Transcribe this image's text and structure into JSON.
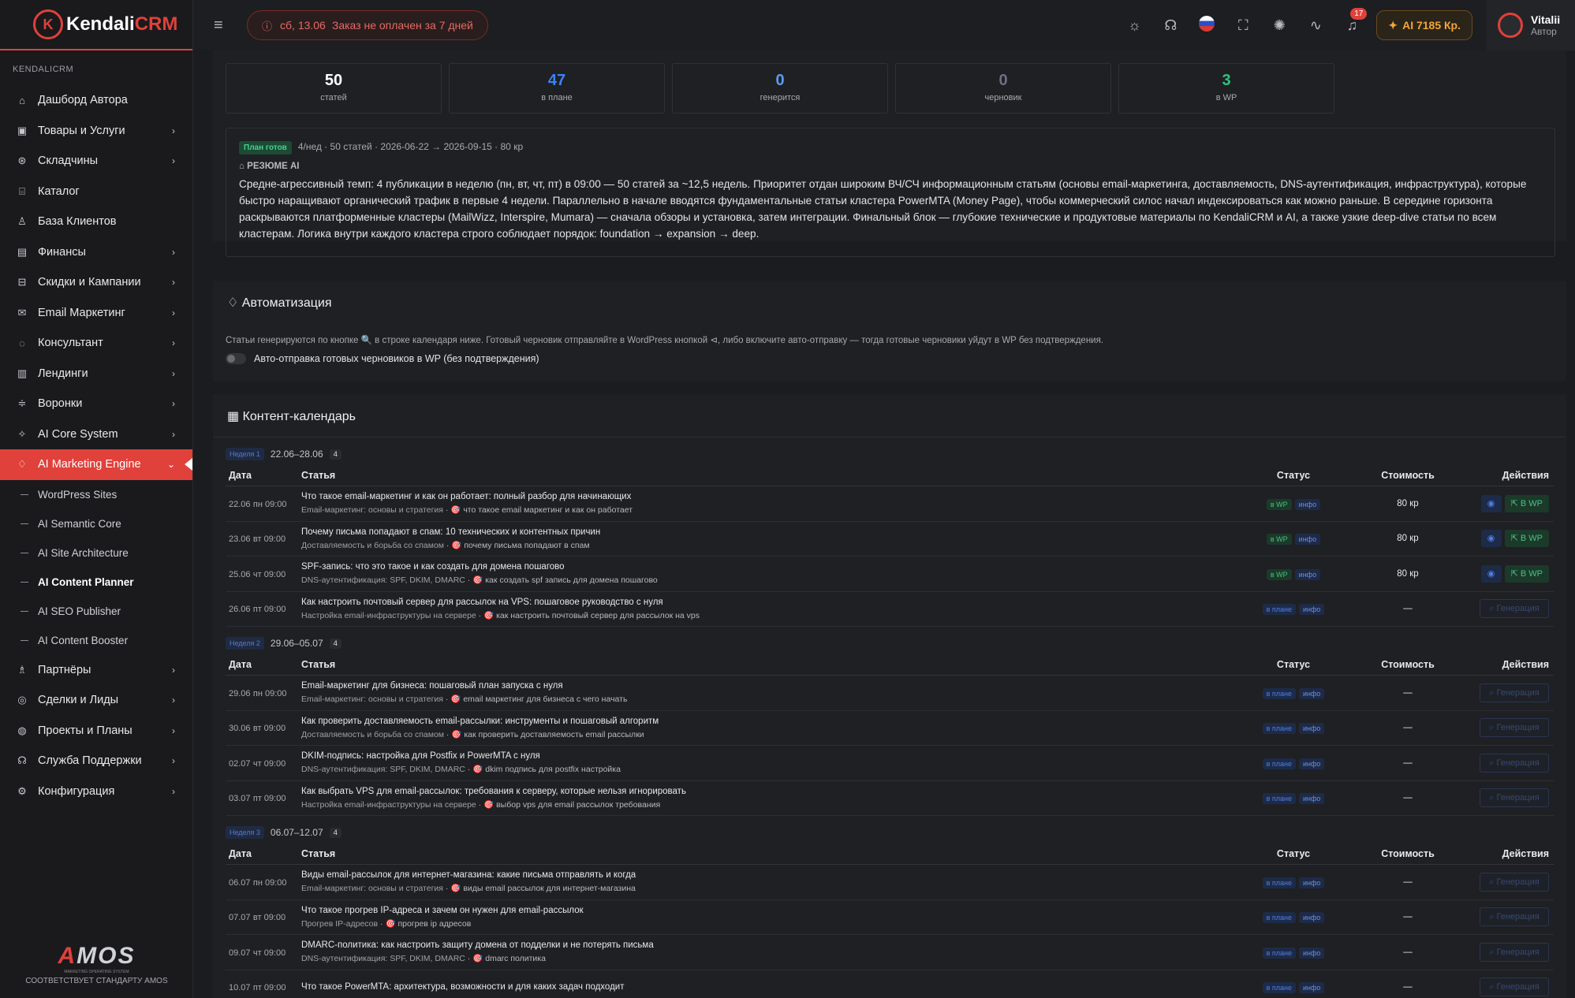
{
  "app": {
    "logo_part1": "Kendali",
    "logo_part2": "CRM",
    "section": "KENDALICRM"
  },
  "menu": [
    {
      "label": "Дашборд Автора",
      "icon": "home-icon",
      "chev": false
    },
    {
      "label": "Товары и Услуги",
      "icon": "box-icon",
      "chev": true
    },
    {
      "label": "Складчины",
      "icon": "share-icon",
      "chev": true
    },
    {
      "label": "Каталог",
      "icon": "store-icon",
      "chev": false
    },
    {
      "label": "База Клиентов",
      "icon": "users-icon",
      "chev": false
    },
    {
      "label": "Финансы",
      "icon": "wallet-icon",
      "chev": true
    },
    {
      "label": "Скидки и Кампании",
      "icon": "tag-icon",
      "chev": true
    },
    {
      "label": "Email Маркетинг",
      "icon": "mail-icon",
      "chev": true
    },
    {
      "label": "Консультант",
      "icon": "chat-icon",
      "chev": true
    },
    {
      "label": "Лендинги",
      "icon": "page-icon",
      "chev": true
    },
    {
      "label": "Воронки",
      "icon": "funnel-icon",
      "chev": true
    },
    {
      "label": "AI Core System",
      "icon": "sparkle-icon",
      "chev": true
    }
  ],
  "active_menu": {
    "label": "AI Marketing Engine",
    "icon": "bell-icon"
  },
  "submenu": [
    "WordPress Sites",
    "AI Semantic Core",
    "AI Site Architecture",
    "AI Content Planner",
    "AI SEO Publisher",
    "AI Content Booster"
  ],
  "menu2": [
    {
      "label": "Партнёры",
      "icon": "partners-icon"
    },
    {
      "label": "Сделки и Лиды",
      "icon": "handshake-icon"
    },
    {
      "label": "Проекты и Планы",
      "icon": "projects-icon"
    },
    {
      "label": "Служба Поддержки",
      "icon": "headset-icon"
    },
    {
      "label": "Конфигурация",
      "icon": "gear-icon"
    }
  ],
  "footer": {
    "brand": "AMOS",
    "tiny": "MARKETING OPERATING SYSTEM",
    "standard": "СООТВЕТСТВУЕТ СТАНДАРТУ AMOS"
  },
  "header": {
    "alert_date": "сб, 13.06",
    "alert_text": "Заказ не оплачен за 7 дней",
    "notif_count": "17",
    "ai_balance": "AI 7185 Кр.",
    "user_name": "Vitalii",
    "user_role": "Автор"
  },
  "stats": [
    {
      "value": "50",
      "label": "статей",
      "color": "#ffffff"
    },
    {
      "value": "47",
      "label": "в плане",
      "color": "#3b82f6"
    },
    {
      "value": "0",
      "label": "генерится",
      "color": "#5b9bf0"
    },
    {
      "value": "0",
      "label": "черновик",
      "color": "#6a7180"
    },
    {
      "value": "3",
      "label": "в WP",
      "color": "#2ec27e"
    }
  ],
  "plan": {
    "tag": "План готов",
    "meta": "4/нед · 50 статей · 2026-06-22 → 2026-09-15 · 80 кр",
    "resume_label": "РЕЗЮМЕ AI",
    "text": "Средне-агрессивный темп: 4 публикации в неделю (пн, вт, чт, пт) в 09:00 — 50 статей за ~12,5 недель. Приоритет отдан широким ВЧ/СЧ информационным статьям (основы email-маркетинга, доставляемость, DNS-аутентификация, инфраструктура), которые быстро наращивают органический трафик в первые 4 недели. Параллельно в начале вводятся фундаментальные статьи кластера PowerMTA (Money Page), чтобы коммерческий силос начал индексироваться как можно раньше. В середине горизонта раскрываются платформенные кластеры (MailWizz, Interspire, Mumara) — сначала обзоры и установка, затем интеграции. Финальный блок — глубокие технические и продуктовые материалы по KendaliCRM и AI, а также узкие deep-dive статьи по всем кластерам. Логика внутри каждого кластера строго соблюдает порядок: foundation → expansion → deep."
  },
  "automation": {
    "title": "Автоматизация",
    "desc": "Статьи генерируются по кнопке 🔍 в строке календаря ниже. Готовый черновик отправляйте в WordPress кнопкой ⊲, либо включите авто-отправку — тогда готовые черновики уйдут в WP без подтверждения.",
    "toggle_label": "Авто-отправка готовых черновиков в WP (без подтверждения)"
  },
  "calendar": {
    "title": "Контент-календарь",
    "columns": {
      "date": "Дата",
      "article": "Статья",
      "status": "Статус",
      "cost": "Стоимость",
      "actions": "Действия"
    },
    "labels": {
      "wp": "в WP",
      "plan": "в плане",
      "info": "инфо",
      "eye": "◉",
      "to_wp": "⇱ В WP",
      "gen": "⌕ Генерация",
      "dash": "—"
    },
    "weeks": [
      {
        "tag": "Неделя 1",
        "range": "22.06–28.06",
        "count": "4",
        "rows": [
          {
            "date": "22.06",
            "day": "пн 09:00",
            "title": "Что такое email-маркетинг и как он работает: полный разбор для начинающих",
            "cluster": "Email-маркетинг: основы и стратегия",
            "kw": "что такое email маркетинг и как он работает",
            "status": "wp",
            "cost": "80 кр"
          },
          {
            "date": "23.06",
            "day": "вт 09:00",
            "title": "Почему письма попадают в спам: 10 технических и контентных причин",
            "cluster": "Доставляемость и борьба со спамом",
            "kw": "почему письма попадают в спам",
            "status": "wp",
            "cost": "80 кр"
          },
          {
            "date": "25.06",
            "day": "чт 09:00",
            "title": "SPF-запись: что это такое и как создать для домена пошагово",
            "cluster": "DNS-аутентификация: SPF, DKIM, DMARC",
            "kw": "как создать spf запись для домена пошагово",
            "status": "wp",
            "cost": "80 кр"
          },
          {
            "date": "26.06",
            "day": "пт 09:00",
            "title": "Как настроить почтовый сервер для рассылок на VPS: пошаговое руководство с нуля",
            "cluster": "Настройка email-инфраструктуры на сервере",
            "kw": "как настроить почтовый сервер для рассылок на vps",
            "status": "plan",
            "cost": "—"
          }
        ]
      },
      {
        "tag": "Неделя 2",
        "range": "29.06–05.07",
        "count": "4",
        "rows": [
          {
            "date": "29.06",
            "day": "пн 09:00",
            "title": "Email-маркетинг для бизнеса: пошаговый план запуска с нуля",
            "cluster": "Email-маркетинг: основы и стратегия",
            "kw": "email маркетинг для бизнеса с чего начать",
            "status": "plan",
            "cost": "—"
          },
          {
            "date": "30.06",
            "day": "вт 09:00",
            "title": "Как проверить доставляемость email-рассылки: инструменты и пошаговый алгоритм",
            "cluster": "Доставляемость и борьба со спамом",
            "kw": "как проверить доставляемость email рассылки",
            "status": "plan",
            "cost": "—"
          },
          {
            "date": "02.07",
            "day": "чт 09:00",
            "title": "DKIM-подпись: настройка для Postfix и PowerMTA с нуля",
            "cluster": "DNS-аутентификация: SPF, DKIM, DMARC",
            "kw": "dkim подпись для postfix настройка",
            "status": "plan",
            "cost": "—"
          },
          {
            "date": "03.07",
            "day": "пт 09:00",
            "title": "Как выбрать VPS для email-рассылок: требования к серверу, которые нельзя игнорировать",
            "cluster": "Настройка email-инфраструктуры на сервере",
            "kw": "выбор vps для email рассылок требования",
            "status": "plan",
            "cost": "—"
          }
        ]
      },
      {
        "tag": "Неделя 3",
        "range": "06.07–12.07",
        "count": "4",
        "rows": [
          {
            "date": "06.07",
            "day": "пн 09:00",
            "title": "Виды email-рассылок для интернет-магазина: какие письма отправлять и когда",
            "cluster": "Email-маркетинг: основы и стратегия",
            "kw": "виды email рассылок для интернет-магазина",
            "status": "plan",
            "cost": "—"
          },
          {
            "date": "07.07",
            "day": "вт 09:00",
            "title": "Что такое прогрев IP-адреса и зачем он нужен для email-рассылок",
            "cluster": "Прогрев IP-адресов",
            "kw": "прогрев ip адресов",
            "status": "plan",
            "cost": "—"
          },
          {
            "date": "09.07",
            "day": "чт 09:00",
            "title": "DMARC-политика: как настроить защиту домена от подделки и не потерять письма",
            "cluster": "DNS-аутентификация: SPF, DKIM, DMARC",
            "kw": "dmarc политика",
            "status": "plan",
            "cost": "—"
          },
          {
            "date": "10.07",
            "day": "пт 09:00",
            "title": "Что такое PowerMTA: архитектура, возможности и для каких задач подходит",
            "cluster": "",
            "kw": "",
            "status": "plan",
            "cost": "—"
          }
        ]
      }
    ]
  }
}
